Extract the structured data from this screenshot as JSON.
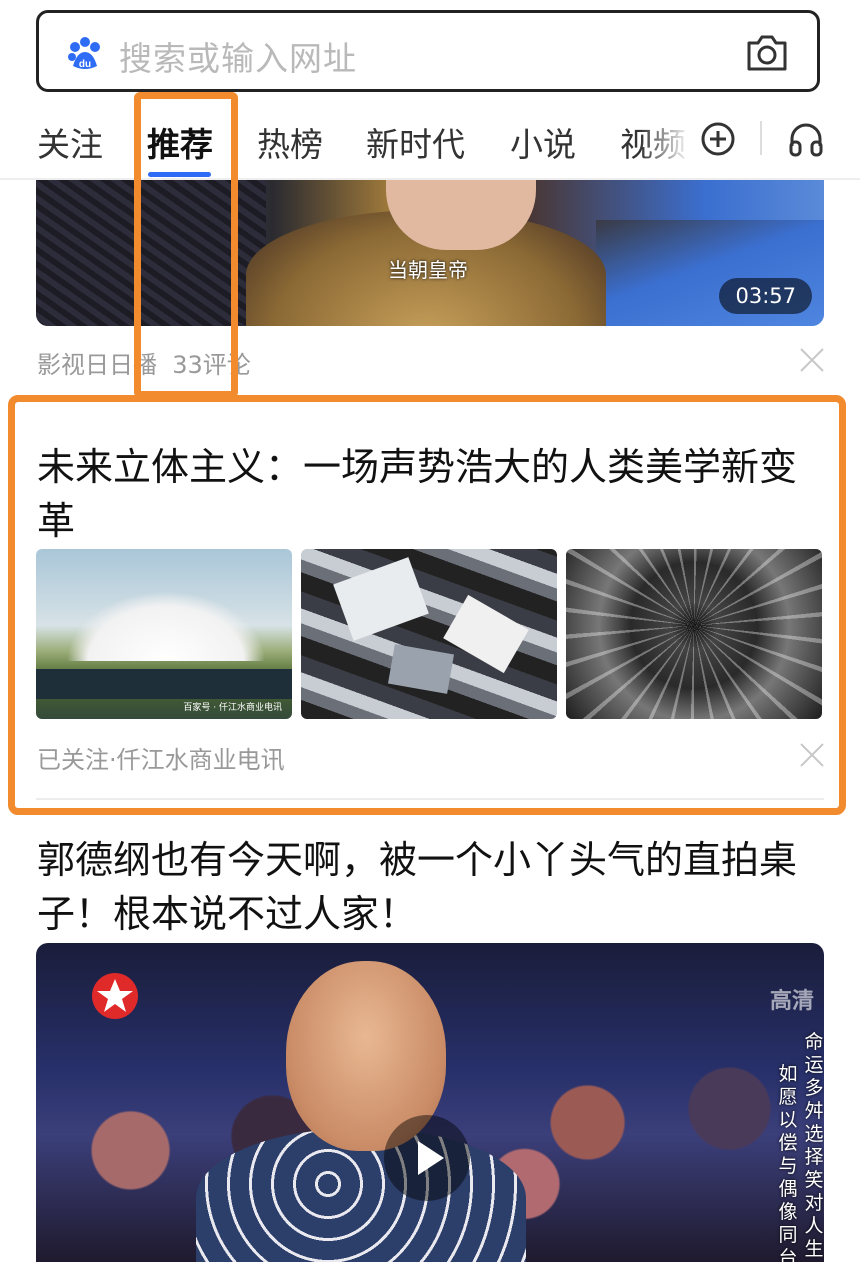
{
  "search": {
    "placeholder": "搜索或输入网址"
  },
  "tabs": [
    {
      "label": "关注"
    },
    {
      "label": "推荐",
      "active": true
    },
    {
      "label": "热榜"
    },
    {
      "label": "新时代"
    },
    {
      "label": "小说"
    },
    {
      "label": "视频"
    }
  ],
  "feed": [
    {
      "type": "video",
      "subtitle": "当朝皇帝",
      "duration": "03:57",
      "source": "影视日日播",
      "comments": "33评论"
    },
    {
      "type": "article",
      "title": "未来立体主义：一场声势浩大的人类美学新变革",
      "thumb_watermark": "百家号 · 仟江水商业电讯",
      "source": "已关注·仟江水商业电讯"
    },
    {
      "type": "video",
      "title": "郭德纲也有今天啊，被一个小丫头气的直拍桌子！根本说不过人家！",
      "hd_label": "高清",
      "caption_col1": "命运多舛选择笑对人生",
      "caption_col2": "如愿以偿与偶像同台飙戏"
    }
  ],
  "colors": {
    "accent": "#2f6cf5",
    "highlight": "#f28a2e"
  },
  "icons": [
    "baidu-logo-icon",
    "camera-icon",
    "plus-icon",
    "headphone-icon",
    "close-icon",
    "play-icon"
  ]
}
